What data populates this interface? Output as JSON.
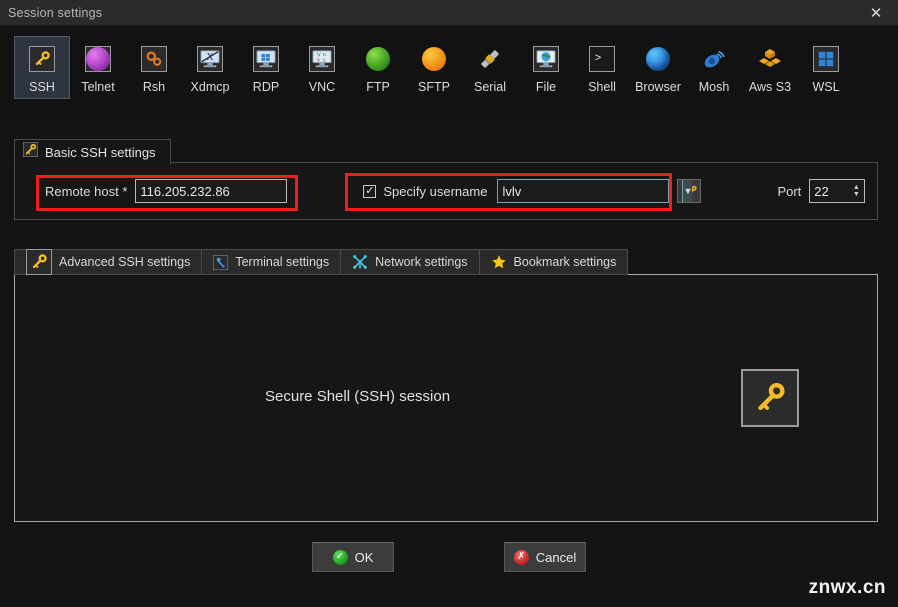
{
  "window": {
    "title": "Session settings",
    "close_label": "✕"
  },
  "protocols": [
    {
      "label": "SSH",
      "icon": "ssh-key-icon",
      "selected": true
    },
    {
      "label": "Telnet",
      "icon": "telnet-blob-icon",
      "selected": false
    },
    {
      "label": "Rsh",
      "icon": "rsh-gears-icon",
      "selected": false
    },
    {
      "label": "Xdmcp",
      "icon": "xdmcp-monitor-icon",
      "selected": false
    },
    {
      "label": "RDP",
      "icon": "rdp-monitor-icon",
      "selected": false
    },
    {
      "label": "VNC",
      "icon": "vnc-monitor-icon",
      "selected": false
    },
    {
      "label": "FTP",
      "icon": "ftp-globe-icon",
      "selected": false
    },
    {
      "label": "SFTP",
      "icon": "sftp-globe-icon",
      "selected": false
    },
    {
      "label": "Serial",
      "icon": "serial-plug-icon",
      "selected": false
    },
    {
      "label": "File",
      "icon": "file-monitor-icon",
      "selected": false
    },
    {
      "label": "Shell",
      "icon": "shell-prompt-icon",
      "selected": false
    },
    {
      "label": "Browser",
      "icon": "browser-globe-icon",
      "selected": false
    },
    {
      "label": "Mosh",
      "icon": "mosh-satellite-icon",
      "selected": false
    },
    {
      "label": "Aws S3",
      "icon": "aws-s3-cubes-icon",
      "selected": false
    },
    {
      "label": "WSL",
      "icon": "wsl-windows-icon",
      "selected": false
    }
  ],
  "basic_group": {
    "tab_label": "Basic SSH settings",
    "tab_icon": "ssh-key-icon",
    "remote_host_label": "Remote host *",
    "remote_host_value": "116.205.232.86",
    "remote_host_placeholder": "",
    "specify_username_label": "Specify username",
    "specify_username_checked": true,
    "checkmark": "✓",
    "username_value": "lvlv",
    "username_placeholder": "",
    "username_dropdown_icon": "chevron-down-icon",
    "user_picker_icon": "user-key-icon",
    "port_label": "Port",
    "port_value": "22"
  },
  "settings_tabs": [
    {
      "label": "Advanced SSH settings",
      "icon": "ssh-key-icon"
    },
    {
      "label": "Terminal settings",
      "icon": "terminal-icon"
    },
    {
      "label": "Network settings",
      "icon": "network-nodes-icon"
    },
    {
      "label": "Bookmark settings",
      "icon": "star-icon"
    }
  ],
  "panel": {
    "caption": "Secure Shell (SSH) session",
    "big_icon": "ssh-key-icon"
  },
  "footer": {
    "ok_label": "OK",
    "ok_icon": "check-circle-icon",
    "cancel_label": "Cancel",
    "cancel_icon": "x-circle-icon"
  },
  "watermark": "znwx.cn",
  "colors": {
    "window_bg": "#141414",
    "titlebar_bg": "#2b2b2b",
    "panel_bg": "#161616",
    "accent_red": "#ef1d1d",
    "selected_proto_bg": "#2f3540",
    "key_yellow": "#f2bc28",
    "ok_green": "#189a18",
    "cancel_red": "#c51f1f"
  }
}
